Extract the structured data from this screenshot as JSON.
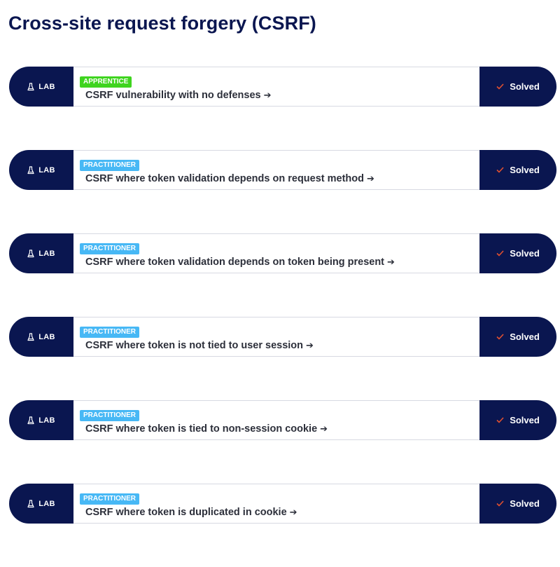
{
  "page": {
    "title": "Cross-site request forgery (CSRF)"
  },
  "colors": {
    "navy": "#0a1650",
    "apprentice": "#3fd41f",
    "practitioner": "#47b8f5",
    "check": "#e2502f"
  },
  "labs": [
    {
      "tag": "LAB",
      "level": "APPRENTICE",
      "title": "CSRF vulnerability with no defenses",
      "arrow": "➔",
      "status": "Solved"
    },
    {
      "tag": "LAB",
      "level": "PRACTITIONER",
      "title": "CSRF where token validation depends on request method",
      "arrow": "➔",
      "status": "Solved"
    },
    {
      "tag": "LAB",
      "level": "PRACTITIONER",
      "title": "CSRF where token validation depends on token being present",
      "arrow": "➔",
      "status": "Solved"
    },
    {
      "tag": "LAB",
      "level": "PRACTITIONER",
      "title": "CSRF where token is not tied to user session",
      "arrow": "➔",
      "status": "Solved"
    },
    {
      "tag": "LAB",
      "level": "PRACTITIONER",
      "title": "CSRF where token is tied to non-session cookie",
      "arrow": "➔",
      "status": "Solved"
    },
    {
      "tag": "LAB",
      "level": "PRACTITIONER",
      "title": "CSRF where token is duplicated in cookie",
      "arrow": "➔",
      "status": "Solved"
    }
  ]
}
